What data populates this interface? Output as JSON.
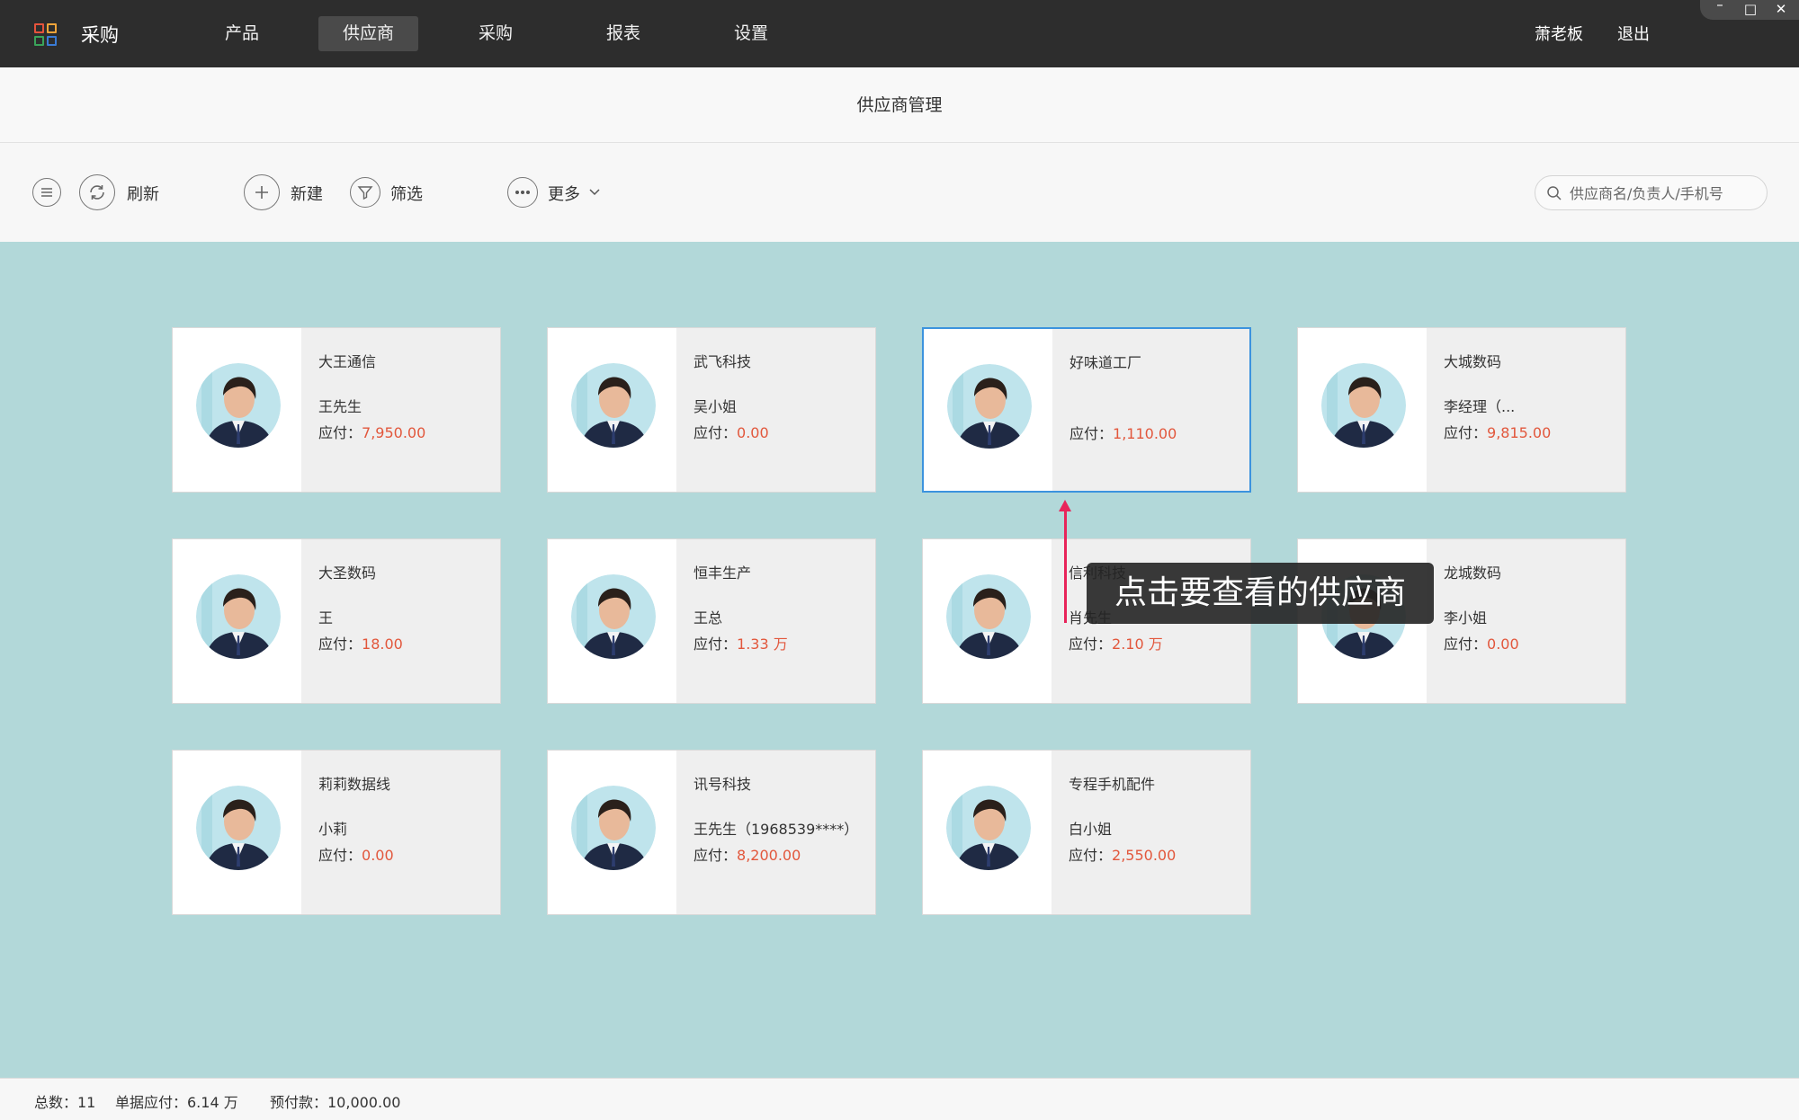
{
  "app": {
    "title": "采购",
    "logo_colors": [
      "#e5533c",
      "#f0a43a",
      "#3aa35a",
      "#3a7bd5"
    ]
  },
  "nav": {
    "items": [
      {
        "label": "产品"
      },
      {
        "label": "供应商",
        "active": true
      },
      {
        "label": "采购"
      },
      {
        "label": "报表"
      },
      {
        "label": "设置"
      }
    ],
    "user": "萧老板",
    "logout": "退出"
  },
  "window_controls": {
    "minimize": "–",
    "maximize": "□",
    "close": "✕"
  },
  "page": {
    "title": "供应商管理"
  },
  "toolbar": {
    "menu_icon": "menu-icon",
    "refresh_label": "刷新",
    "new_label": "新建",
    "filter_label": "筛选",
    "more_label": "更多",
    "search_placeholder": "供应商名/负责人/手机号"
  },
  "suppliers": [
    {
      "name": "大王通信",
      "contact": "王先生",
      "payable_label": "应付：",
      "payable": "7,950.00"
    },
    {
      "name": "武飞科技",
      "contact": "吴小姐",
      "payable_label": "应付：",
      "payable": "0.00"
    },
    {
      "name": "好味道工厂",
      "contact": "",
      "payable_label": "应付：",
      "payable": "1,110.00",
      "selected": true
    },
    {
      "name": "大城数码",
      "contact": "李经理（...",
      "payable_label": "应付：",
      "payable": "9,815.00"
    },
    {
      "name": "大圣数码",
      "contact": "王",
      "payable_label": "应付：",
      "payable": "18.00"
    },
    {
      "name": "恒丰生产",
      "contact": "王总",
      "payable_label": "应付：",
      "payable": "1.33 万"
    },
    {
      "name": "信利科技",
      "contact": "肖先生",
      "payable_label": "应付：",
      "payable": "2.10 万"
    },
    {
      "name": "龙城数码",
      "contact": "李小姐",
      "payable_label": "应付：",
      "payable": "0.00"
    },
    {
      "name": "莉莉数据线",
      "contact": "小莉",
      "payable_label": "应付：",
      "payable": "0.00"
    },
    {
      "name": "讯号科技",
      "contact": "王先生（1968539****）",
      "payable_label": "应付：",
      "payable": "8,200.00"
    },
    {
      "name": "专程手机配件",
      "contact": "白小姐",
      "payable_label": "应付：",
      "payable": "2,550.00"
    }
  ],
  "hint": {
    "text": "点击要查看的供应商"
  },
  "footer": {
    "total": "总数：11",
    "bill_payable": "单据应付：6.14 万",
    "prepaid": "预付款：10,000.00"
  },
  "colors": {
    "accent": "#3c93de",
    "amount": "#e2573c",
    "background": "#b2d8d9",
    "hint_arrow": "#e8245a"
  }
}
